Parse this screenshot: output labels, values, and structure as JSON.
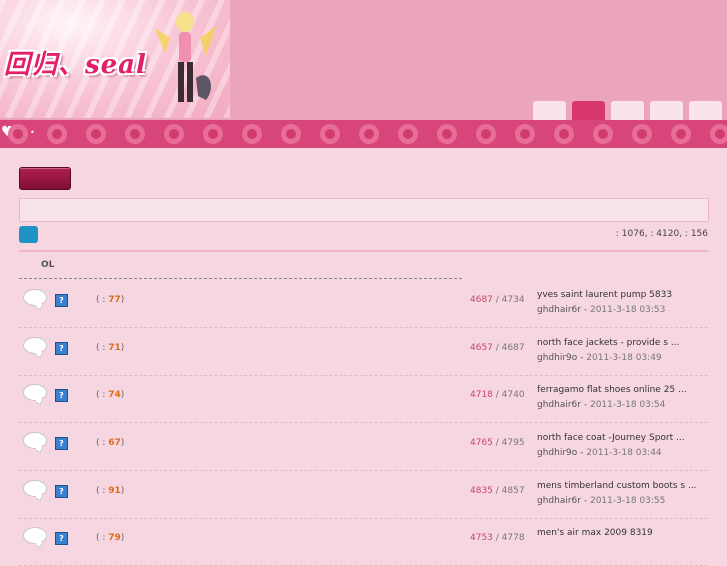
{
  "header": {
    "logo_text": "回归、seal",
    "tabs": [
      "",
      "",
      "",
      "",
      ""
    ]
  },
  "toolbar": {
    "post_button_label": "",
    "notice_text": "",
    "stats_text": ": 1076,   : 4120,   : 156"
  },
  "thread_list": {
    "column_header": "OL",
    "threads": [
      {
        "pages": "( : ",
        "page_count": "77",
        "close": ")",
        "replies": "4687",
        "views": "4734",
        "last_title": "yves saint laurent pump 5833",
        "last_author": "ghdhair6r",
        "last_time": "2011-3-18 03:53"
      },
      {
        "pages": "( : ",
        "page_count": "71",
        "close": ")",
        "replies": "4657",
        "views": "4687",
        "last_title": "north face jackets - provide s ...",
        "last_author": "ghdhir9o",
        "last_time": "2011-3-18 03:49"
      },
      {
        "pages": "( : ",
        "page_count": "74",
        "close": ")",
        "replies": "4718",
        "views": "4740",
        "last_title": "ferragamo flat shoes online 25 ...",
        "last_author": "ghdhair6r",
        "last_time": "2011-3-18 03:54"
      },
      {
        "pages": "( : ",
        "page_count": "67",
        "close": ")",
        "replies": "4765",
        "views": "4795",
        "last_title": "north face coat -Journey Sport ...",
        "last_author": "ghdhir9o",
        "last_time": "2011-3-18 03:44"
      },
      {
        "pages": "( : ",
        "page_count": "91",
        "close": ")",
        "replies": "4835",
        "views": "4857",
        "last_title": "mens timberland custom boots s ...",
        "last_author": "ghdhair6r",
        "last_time": "2011-3-18 03:55"
      },
      {
        "pages": "( : ",
        "page_count": "79",
        "close": ")",
        "replies": "4753",
        "views": "4778",
        "last_title": "men's air max 2009 8319",
        "last_author": "",
        "last_time": ""
      }
    ]
  }
}
